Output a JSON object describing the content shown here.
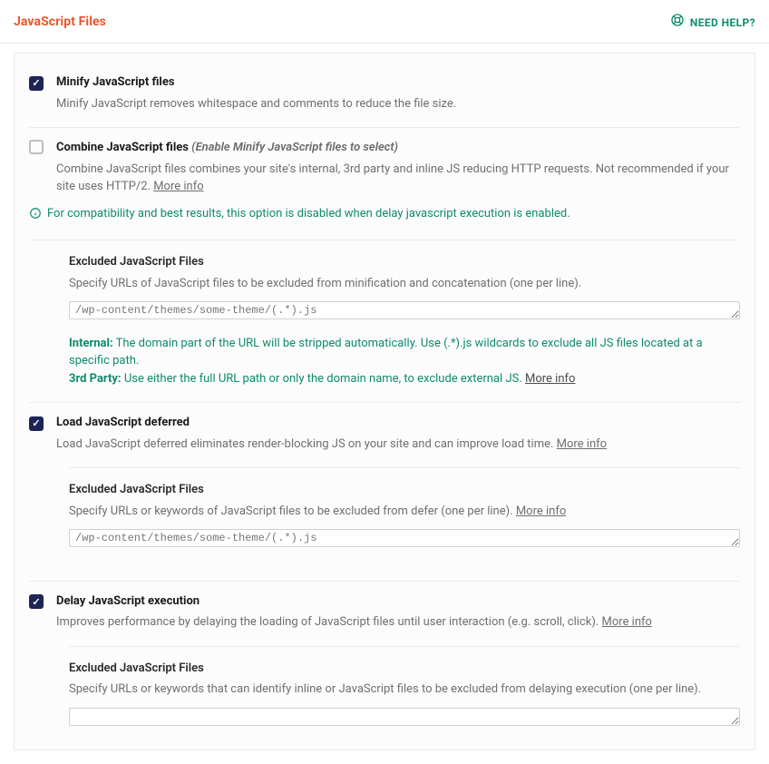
{
  "header": {
    "title": "JavaScript Files",
    "need_help": "NEED HELP?"
  },
  "minify": {
    "title": "Minify JavaScript files",
    "desc": "Minify JavaScript removes whitespace and comments to reduce the file size.",
    "checked": true
  },
  "combine": {
    "title": "Combine JavaScript files",
    "hint": "(Enable Minify JavaScript files to select)",
    "desc": "Combine JavaScript files combines your site's internal, 3rd party and inline JS reducing HTTP requests. Not recommended if your site uses HTTP/2.",
    "more_info": "More info",
    "checked": false
  },
  "compat_note": "For compatibility and best results, this option is disabled when delay javascript execution is enabled.",
  "excluded_minify": {
    "title": "Excluded JavaScript Files",
    "desc": "Specify URLs of JavaScript files to be excluded from minification and concatenation (one per line).",
    "placeholder": "/wp-content/themes/some-theme/(.*).js",
    "internal_label": "Internal:",
    "internal_text": "The domain part of the URL will be stripped automatically. Use (.*).js wildcards to exclude all JS files located at a specific path.",
    "third_label": "3rd Party:",
    "third_text": "Use either the full URL path or only the domain name, to exclude external JS.",
    "more_info": "More info"
  },
  "defer": {
    "title": "Load JavaScript deferred",
    "desc": "Load JavaScript deferred eliminates render-blocking JS on your site and can improve load time.",
    "more_info": "More info",
    "checked": true
  },
  "excluded_defer": {
    "title": "Excluded JavaScript Files",
    "desc": "Specify URLs or keywords of JavaScript files to be excluded from defer (one per line).",
    "more_info": "More info",
    "placeholder": "/wp-content/themes/some-theme/(.*).js"
  },
  "delay": {
    "title": "Delay JavaScript execution",
    "desc": "Improves performance by delaying the loading of JavaScript files until user interaction (e.g. scroll, click).",
    "more_info": "More info",
    "checked": true
  },
  "excluded_delay": {
    "title": "Excluded JavaScript Files",
    "desc": "Specify URLs or keywords that can identify inline or JavaScript files to be excluded from delaying execution (one per line).",
    "placeholder": ""
  }
}
